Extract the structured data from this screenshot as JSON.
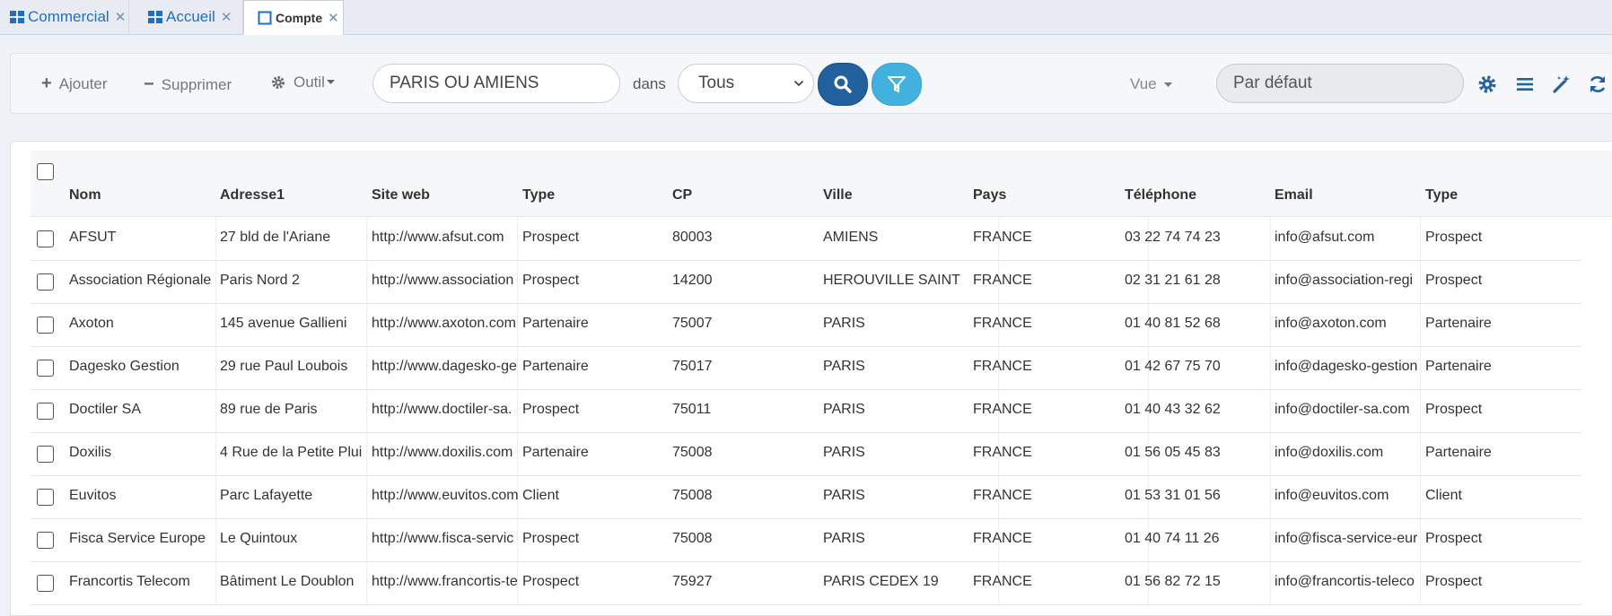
{
  "tabs": [
    {
      "label": "Commercial",
      "icon": "windows-grid-icon",
      "active": false
    },
    {
      "label": "Accueil",
      "icon": "windows-grid-icon",
      "active": false
    },
    {
      "label": "Compte",
      "icon": "square-icon",
      "active": true
    }
  ],
  "toolbar": {
    "add_label": "Ajouter",
    "delete_label": "Supprimer",
    "tool_label": "Outil",
    "search_value": "PARIS OU AMIENS",
    "in_label": "dans",
    "scope_value": "Tous",
    "view_label": "Vue",
    "view_value": "Par défaut"
  },
  "colors": {
    "search_button": "#23609e",
    "filter_button": "#43b1de",
    "accent": "#1e6fc0"
  },
  "table": {
    "headers": [
      "Nom",
      "Adresse1",
      "Site web",
      "Type",
      "CP",
      "Ville",
      "Pays",
      "Téléphone",
      "Email",
      "Type"
    ],
    "rows": [
      [
        "AFSUT",
        "27 bld de l'Ariane",
        "http://www.afsut.com",
        "Prospect",
        "80003",
        "AMIENS",
        "FRANCE",
        "03 22 74 74 23",
        "info@afsut.com",
        "Prospect"
      ],
      [
        "Association Régionale",
        "Paris Nord 2",
        "http://www.association",
        "Prospect",
        "14200",
        "HEROUVILLE SAINT",
        "FRANCE",
        "02 31 21 61 28",
        "info@association-regi",
        "Prospect"
      ],
      [
        "Axoton",
        "145 avenue Gallieni",
        "http://www.axoton.com",
        "Partenaire",
        "75007",
        "PARIS",
        "FRANCE",
        "01 40 81 52 68",
        "info@axoton.com",
        "Partenaire"
      ],
      [
        "Dagesko Gestion",
        "29 rue Paul Loubois",
        "http://www.dagesko-ge",
        "Partenaire",
        "75017",
        "PARIS",
        "FRANCE",
        "01 42 67 75 70",
        "info@dagesko-gestion",
        "Partenaire"
      ],
      [
        "Doctiler SA",
        "89 rue de Paris",
        "http://www.doctiler-sa.",
        "Prospect",
        "75011",
        "PARIS",
        "FRANCE",
        "01 40 43 32 62",
        "info@doctiler-sa.com",
        "Prospect"
      ],
      [
        "Doxilis",
        "4 Rue de la Petite Plui",
        "http://www.doxilis.com",
        "Partenaire",
        "75008",
        "PARIS",
        "FRANCE",
        "01 56 05 45 83",
        "info@doxilis.com",
        "Partenaire"
      ],
      [
        "Euvitos",
        "Parc Lafayette",
        "http://www.euvitos.com",
        "Client",
        "75008",
        "PARIS",
        "FRANCE",
        "01 53 31 01 56",
        "info@euvitos.com",
        "Client"
      ],
      [
        "Fisca Service Europe",
        "Le Quintoux",
        "http://www.fisca-servic",
        "Prospect",
        "75008",
        "PARIS",
        "FRANCE",
        "01 40 74 11 26",
        "info@fisca-service-eur",
        "Prospect"
      ],
      [
        "Francortis Telecom",
        "Bâtiment Le Doublon",
        "http://www.francortis-te",
        "Prospect",
        "75927",
        "PARIS CEDEX 19",
        "FRANCE",
        "01 56 82 72 15",
        "info@francortis-teleco",
        "Prospect"
      ]
    ]
  }
}
